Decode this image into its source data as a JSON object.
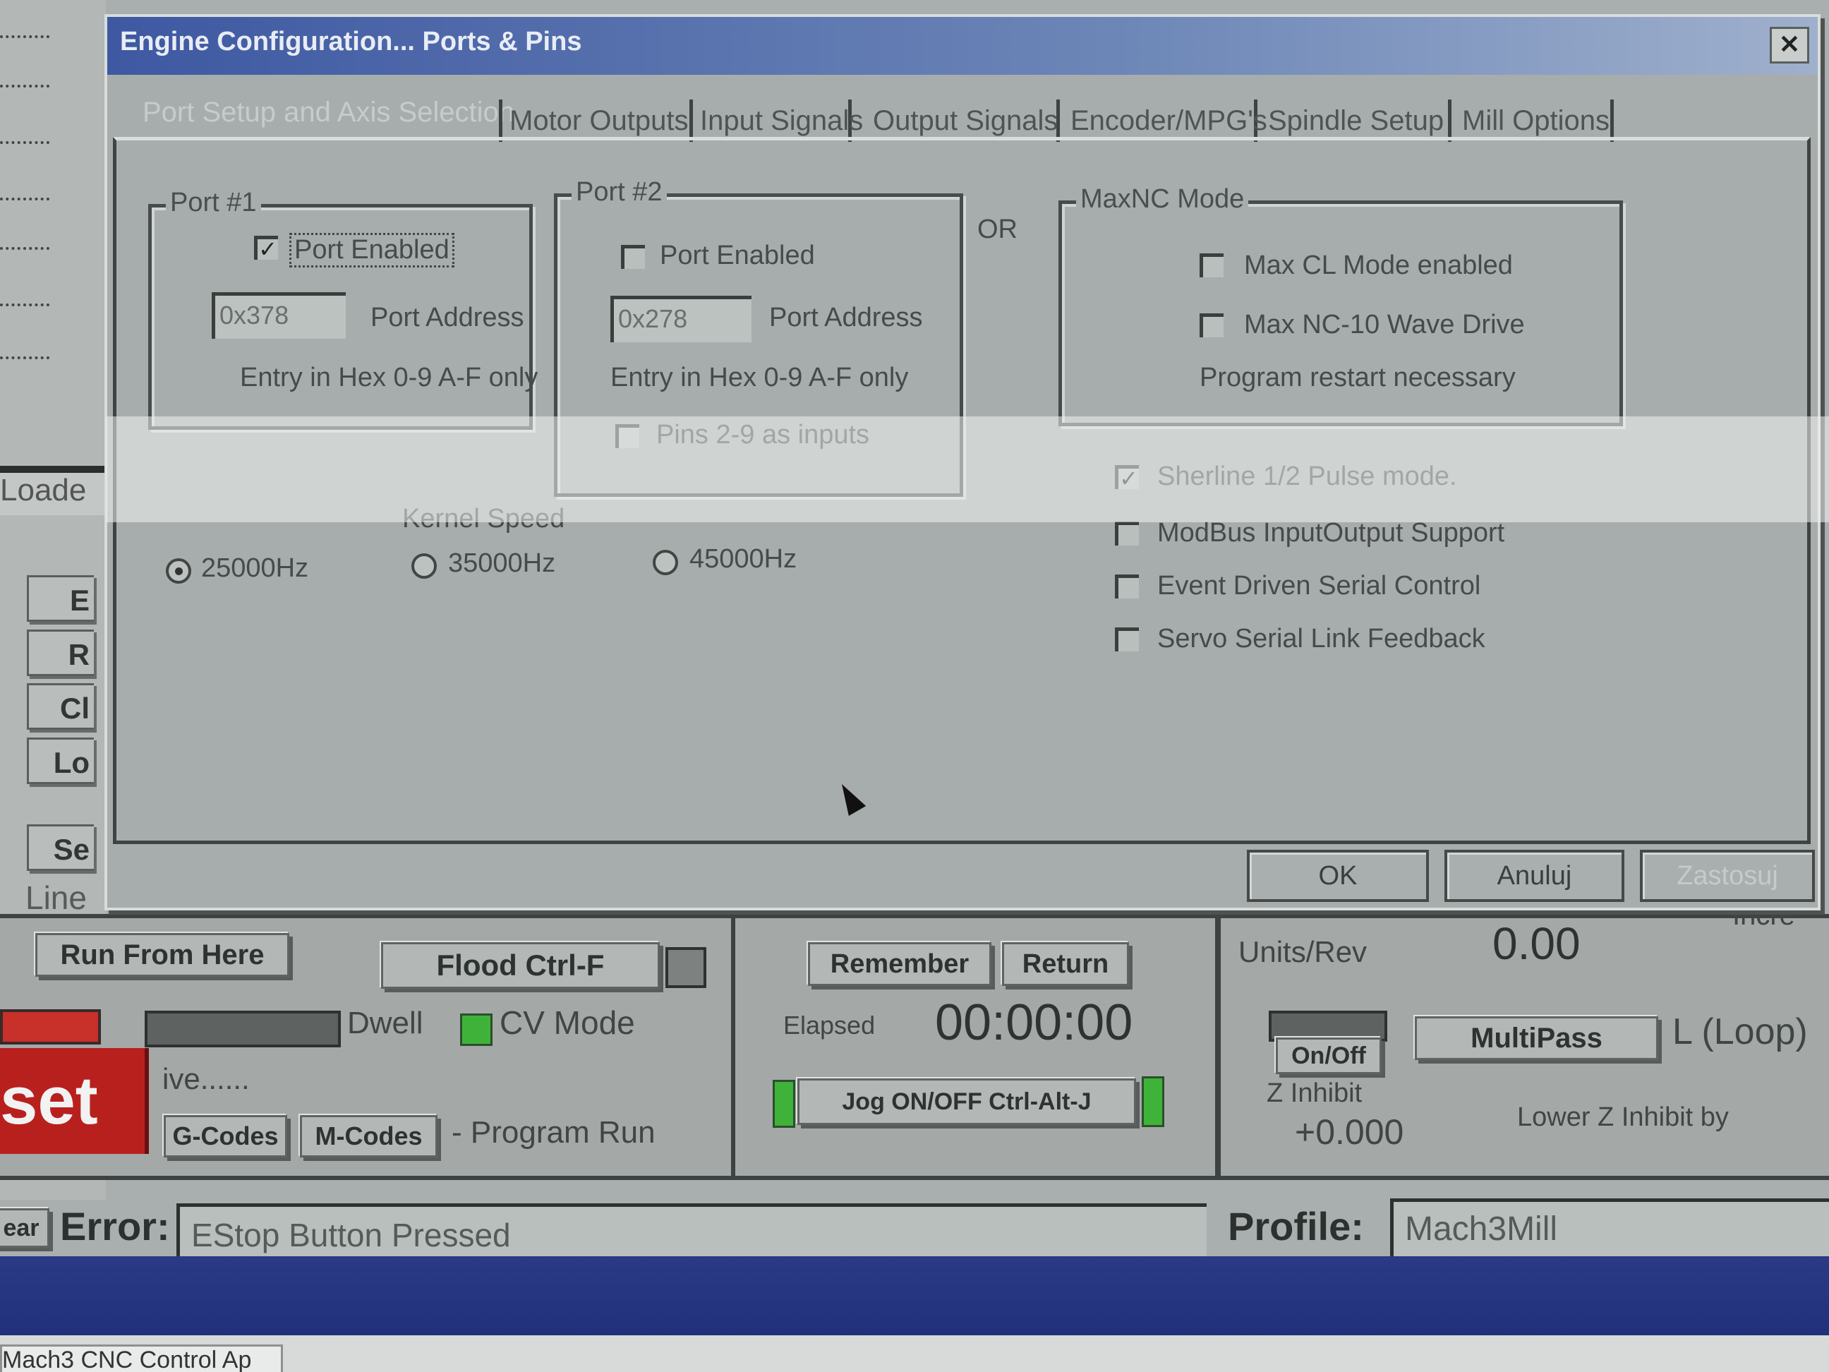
{
  "dialog": {
    "title": "Engine Configuration... Ports & Pins",
    "close": "✕",
    "tabs": [
      "Port Setup and Axis Selection",
      "Motor Outputs",
      "Input Signals",
      "Output Signals",
      "Encoder/MPG's",
      "Spindle Setup",
      "Mill Options"
    ],
    "port1": {
      "title": "Port #1",
      "enabled_label": "Port Enabled",
      "enabled": true,
      "address": "0x378",
      "address_label": "Port Address",
      "hint": "Entry in Hex 0-9 A-F only"
    },
    "port2": {
      "title": "Port #2",
      "enabled_label": "Port Enabled",
      "enabled": false,
      "address": "0x278",
      "address_label": "Port Address",
      "hint": "Entry in Hex 0-9 A-F only",
      "pins_label": "Pins 2-9 as inputs"
    },
    "or_label": "OR",
    "maxnc": {
      "title": "MaxNC Mode",
      "cl_label": "Max CL Mode enabled",
      "wave_label": "Max NC-10 Wave Drive",
      "note": "Program restart necessary"
    },
    "kernel": {
      "title": "Kernel Speed",
      "options": [
        "25000Hz",
        "35000Hz",
        "45000Hz"
      ],
      "selected": "25000Hz"
    },
    "options": [
      {
        "label": "Sherline 1/2 Pulse mode.",
        "checked": true
      },
      {
        "label": "ModBus InputOutput Support",
        "checked": false
      },
      {
        "label": "Event Driven Serial Control",
        "checked": false
      },
      {
        "label": "Servo Serial Link Feedback",
        "checked": false
      }
    ],
    "buttons": {
      "ok": "OK",
      "cancel": "Anuluj",
      "apply": "Zastosuj"
    },
    "check_mark": "✓"
  },
  "background": {
    "loaded": "Loade",
    "side_buttons": [
      "E",
      "R",
      "Cl",
      "Lo",
      "Se"
    ],
    "line_label": "Line",
    "run_from_here": "Run From Here",
    "flood": "Flood Ctrl-F",
    "remember": "Remember",
    "return": "Return",
    "units_rev_label": "Units/Rev",
    "units_rev_value": "0.00",
    "incr": "Incre",
    "dwell": "Dwell",
    "cv_mode": "CV Mode",
    "elapsed_label": "Elapsed",
    "elapsed_value": "00:00:00",
    "onoff": "On/Off",
    "multipass": "MultiPass",
    "loop": "L (Loop)",
    "reset": "set",
    "active": "ive......",
    "gcodes": "G-Codes",
    "mcodes": "M-Codes",
    "program_run": "- Program Run",
    "jog": "Jog ON/OFF Ctrl-Alt-J",
    "z_inhibit": "Z Inhibit",
    "z_value": "+0.000",
    "lower_z": "Lower Z Inhibit by",
    "clear": "ear",
    "error_label": "Error:",
    "error_value": "EStop Button Pressed",
    "profile_label": "Profile:",
    "profile_value": "Mach3Mill",
    "task": "Mach3 CNC Control Ap"
  }
}
